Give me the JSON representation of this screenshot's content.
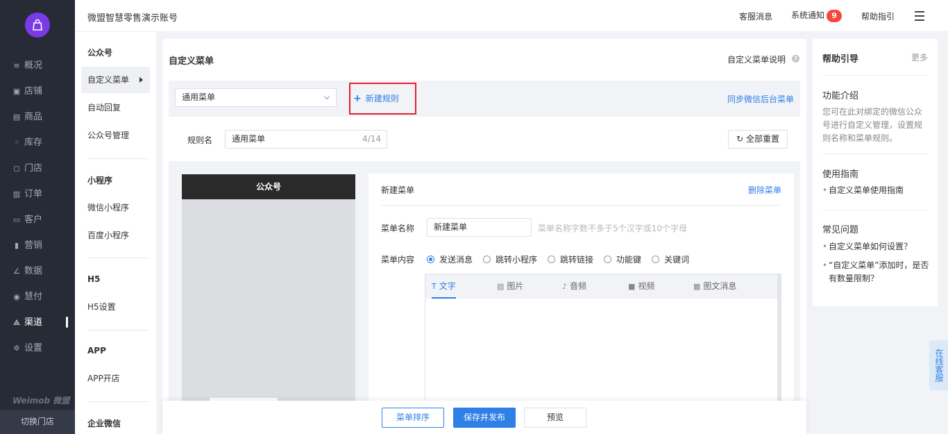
{
  "nav": {
    "items": [
      {
        "label": "概况",
        "icon": "overview-icon"
      },
      {
        "label": "店铺",
        "icon": "store-icon"
      },
      {
        "label": "商品",
        "icon": "goods-icon"
      },
      {
        "label": "库存",
        "icon": "inventory-icon"
      },
      {
        "label": "门店",
        "icon": "shop-icon"
      },
      {
        "label": "订单",
        "icon": "order-icon"
      },
      {
        "label": "客户",
        "icon": "customer-icon"
      },
      {
        "label": "营销",
        "icon": "marketing-icon"
      },
      {
        "label": "数据",
        "icon": "data-icon"
      },
      {
        "label": "慧付",
        "icon": "pay-icon"
      },
      {
        "label": "渠道",
        "icon": "channel-icon",
        "active": true
      },
      {
        "label": "设置",
        "icon": "settings-icon"
      }
    ],
    "brand": "Weimob 微盟",
    "switch_store": "切换门店"
  },
  "header": {
    "title": "微盟智慧零售演示账号",
    "customer_msg": "客服消息",
    "system_notice": "系统通知",
    "notice_count": "9",
    "help": "帮助指引"
  },
  "subnav": {
    "groups": {
      "official": "公众号",
      "mini": "小程序",
      "h5": "H5",
      "app": "APP",
      "enterprise": "企业微信"
    },
    "items": {
      "custom_menu": "自定义菜单",
      "auto_reply": "自动回复",
      "official_manage": "公众号管理",
      "wechat_mini": "微信小程序",
      "baidu_mini": "百度小程序",
      "h5_settings": "H5设置",
      "app_store": "APP开店"
    }
  },
  "main": {
    "title": "自定义菜单",
    "help_link": "自定义菜单说明",
    "select_value": "通用菜单",
    "new_rule": "新建规则",
    "sync": "同步微信后台菜单",
    "rule_label": "规则名",
    "rule_value": "通用菜单",
    "rule_count": "4/14",
    "reset_all": "全部重置",
    "phone_title": "公众号"
  },
  "editor": {
    "title": "新建菜单",
    "delete": "删除菜单",
    "name_label": "菜单名称",
    "name_value": "新建菜单",
    "name_hint": "菜单名称字数不多于5个汉字或10个字母",
    "content_label": "菜单内容",
    "options": [
      "发送消息",
      "跳转小程序",
      "跳转链接",
      "功能键",
      "关键词"
    ],
    "selected_option": "发送消息",
    "tabs": [
      "文字",
      "图片",
      "音频",
      "视频",
      "图文消息"
    ],
    "active_tab": "文字"
  },
  "footer": {
    "sort": "菜单排序",
    "save": "保存并发布",
    "preview": "预览"
  },
  "help": {
    "title": "帮助引导",
    "more": "更多",
    "intro_title": "功能介绍",
    "intro_desc": "您可在此对绑定的微信公众号进行自定义管理，设置规则名称和菜单规则。",
    "guide_title": "使用指南",
    "guide_item": "自定义菜单使用指南",
    "faq_title": "常见问题",
    "faq_1": "自定义菜单如何设置？",
    "faq_2": "“自定义菜单”添加时，是否有数量限制？"
  },
  "online_service": "在线客服",
  "colors": {
    "accent": "#2e7fe6",
    "nav_bg": "#262b36",
    "highlight_border": "#e5212b",
    "badge": "#f5483b",
    "logo": "#7a3be6"
  }
}
